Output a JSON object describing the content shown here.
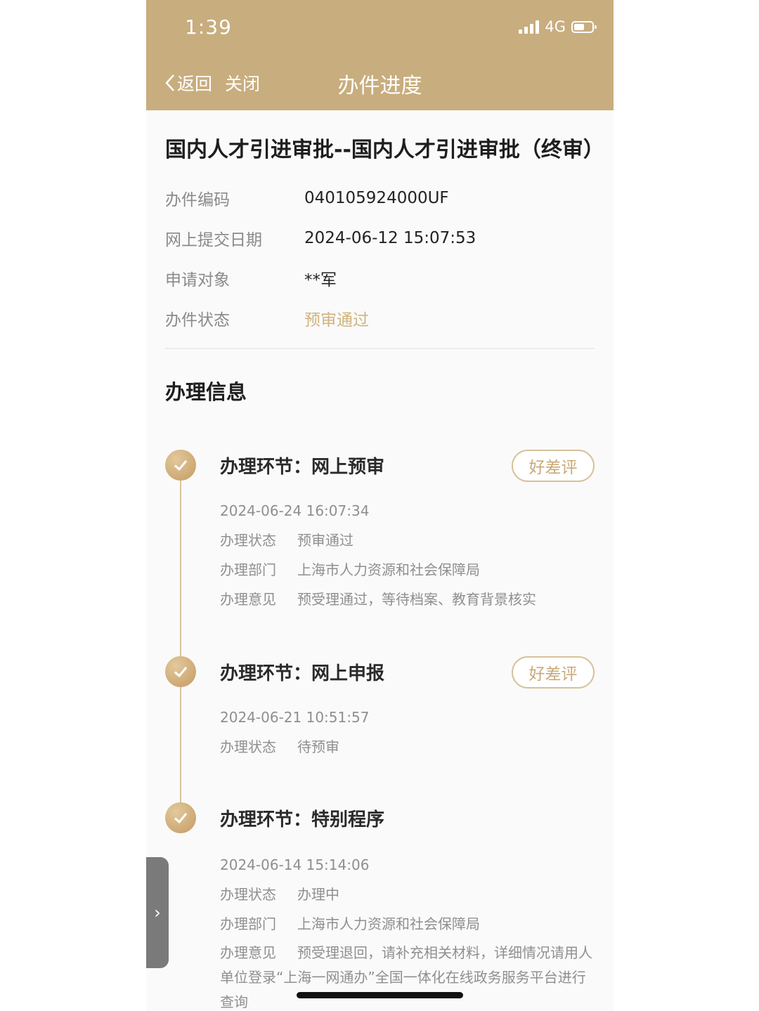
{
  "status_bar": {
    "time": "1:39",
    "network": "4G"
  },
  "nav": {
    "back_label": "返回",
    "close_label": "关闭",
    "title": "办件进度"
  },
  "case": {
    "title": "国内人才引进审批--国内人才引进审批（终审）",
    "fields": [
      {
        "label": "办件编码",
        "value": "040105924000UF"
      },
      {
        "label": "网上提交日期",
        "value": "2024-06-12 15:07:53"
      },
      {
        "label": "申请对象",
        "value": "**军"
      },
      {
        "label": "办件状态",
        "value": "预审通过"
      }
    ]
  },
  "section": {
    "title": "办理信息"
  },
  "steps": [
    {
      "title": "办理环节：网上预审",
      "rate_label": "好差评",
      "time": "2024-06-24 16:07:34",
      "status_label": "办理状态",
      "status": "预审通过",
      "dept_label": "办理部门",
      "dept": "上海市人力资源和社会保障局",
      "opinion_label": "办理意见",
      "opinion": "预受理通过，等待档案、教育背景核实"
    },
    {
      "title": "办理环节：网上申报",
      "rate_label": "好差评",
      "time": "2024-06-21 10:51:57",
      "status_label": "办理状态",
      "status": "待预审"
    },
    {
      "title": "办理环节：特别程序",
      "time": "2024-06-14 15:14:06",
      "status_label": "办理状态",
      "status": "办理中",
      "dept_label": "办理部门",
      "dept": "上海市人力资源和社会保障局",
      "opinion_label": "办理意见",
      "opinion": "预受理退回，请补充相关材料，详细情况请用人单位登录“上海一网通办”全国一体化在线政务服务平台进行查询"
    }
  ],
  "colors": {
    "header": "#c8ad7e",
    "accent_text": "#d2b27c",
    "timeline": "#d9c39d"
  },
  "icons": [
    "back-chevron-icon",
    "signal-icon",
    "battery-icon",
    "check-circle-icon",
    "side-expand-chevron-icon"
  ]
}
